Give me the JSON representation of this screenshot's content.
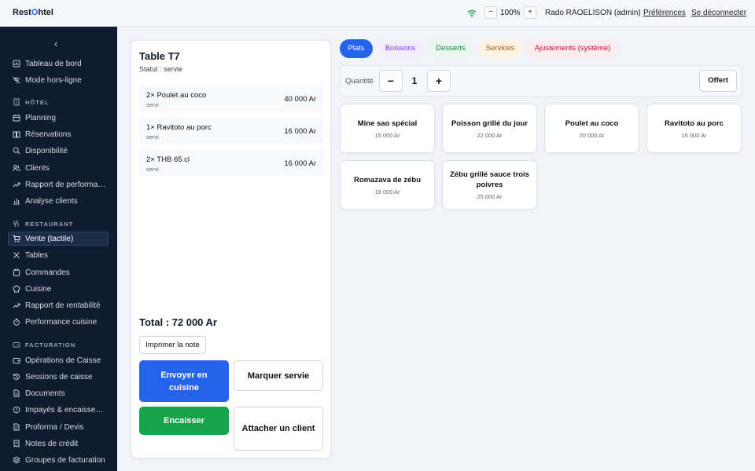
{
  "app": {
    "logo_prefix": "Rest",
    "logo_o": "O",
    "logo_suffix": "htel"
  },
  "topbar": {
    "zoom_minus": "−",
    "zoom_value": "100%",
    "zoom_plus": "+",
    "user": "Rado RAOELISON (admin)",
    "preferences": "Préférences",
    "logout": "Se déconnecter",
    "wifi_icon": "wifi-icon",
    "wifi_color": "#16a34a"
  },
  "sidebar": {
    "collapse_glyph": "‹",
    "top_items": [
      {
        "label": "Tableau de bord",
        "icon": "dashboard-icon"
      },
      {
        "label": "Mode hors-ligne",
        "icon": "wifi-off-icon"
      }
    ],
    "sections": [
      {
        "title": "HÔTEL",
        "items": [
          {
            "label": "Planning"
          },
          {
            "label": "Réservations"
          },
          {
            "label": "Disponibilité"
          },
          {
            "label": "Clients"
          },
          {
            "label": "Rapport de performance"
          },
          {
            "label": "Analyse clients"
          }
        ]
      },
      {
        "title": "RESTAURANT",
        "items": [
          {
            "label": "Vente (tactile)",
            "active": true
          },
          {
            "label": "Tables"
          },
          {
            "label": "Commandes"
          },
          {
            "label": "Cuisine"
          },
          {
            "label": "Rapport de rentabilité"
          },
          {
            "label": "Performance cuisine"
          }
        ]
      },
      {
        "title": "FACTURATION",
        "items": [
          {
            "label": "Opérations de Caisse"
          },
          {
            "label": "Sessions de caisse"
          },
          {
            "label": "Documents"
          },
          {
            "label": "Impayés & encaissements"
          },
          {
            "label": "Proforma / Devis"
          },
          {
            "label": "Notes de crédit"
          },
          {
            "label": "Groupes de facturation"
          }
        ]
      }
    ]
  },
  "order": {
    "table_title": "Table T7",
    "status": "Statut : servie",
    "lines": [
      {
        "name": "2× Poulet au coco",
        "state": "servi",
        "price": "40 000 Ar"
      },
      {
        "name": "1× Ravitoto au porc",
        "state": "servi",
        "price": "16 000 Ar"
      },
      {
        "name": "2× THB 65 cl",
        "state": "servi",
        "price": "16 000 Ar"
      }
    ],
    "total": "Total : 72 000 Ar",
    "print_label": "Imprimer la note",
    "send_kitchen_label": "Envoyer en cuisine",
    "mark_served_label": "Marquer servie",
    "cash_in_label": "Encaisser",
    "attach_client_label": "Attacher un client"
  },
  "categories": [
    {
      "label": "Plats",
      "active": true
    },
    {
      "label": "Boissons"
    },
    {
      "label": "Desserts"
    },
    {
      "label": "Services"
    },
    {
      "label": "Ajustements (système)"
    }
  ],
  "quantity": {
    "label": "Quantité",
    "minus": "−",
    "value": "1",
    "plus": "+",
    "offert_label": "Offert"
  },
  "products": [
    {
      "name": "Mine sao spécial",
      "price": "15 000 Ar"
    },
    {
      "name": "Poisson grillé du jour",
      "price": "22 000 Ar"
    },
    {
      "name": "Poulet au coco",
      "price": "20 000 Ar"
    },
    {
      "name": "Ravitoto au porc",
      "price": "16 000 Ar"
    },
    {
      "name": "Romazava de zébu",
      "price": "18 000 Ar"
    },
    {
      "name": "Zébu grillé sauce trois poivres",
      "price": "25 000 Ar"
    }
  ],
  "colors": {
    "sidebar_bg": "#0f1b2e",
    "accent_blue": "#2563eb",
    "accent_green": "#16a34a",
    "logo_accent": "#2563eb"
  }
}
